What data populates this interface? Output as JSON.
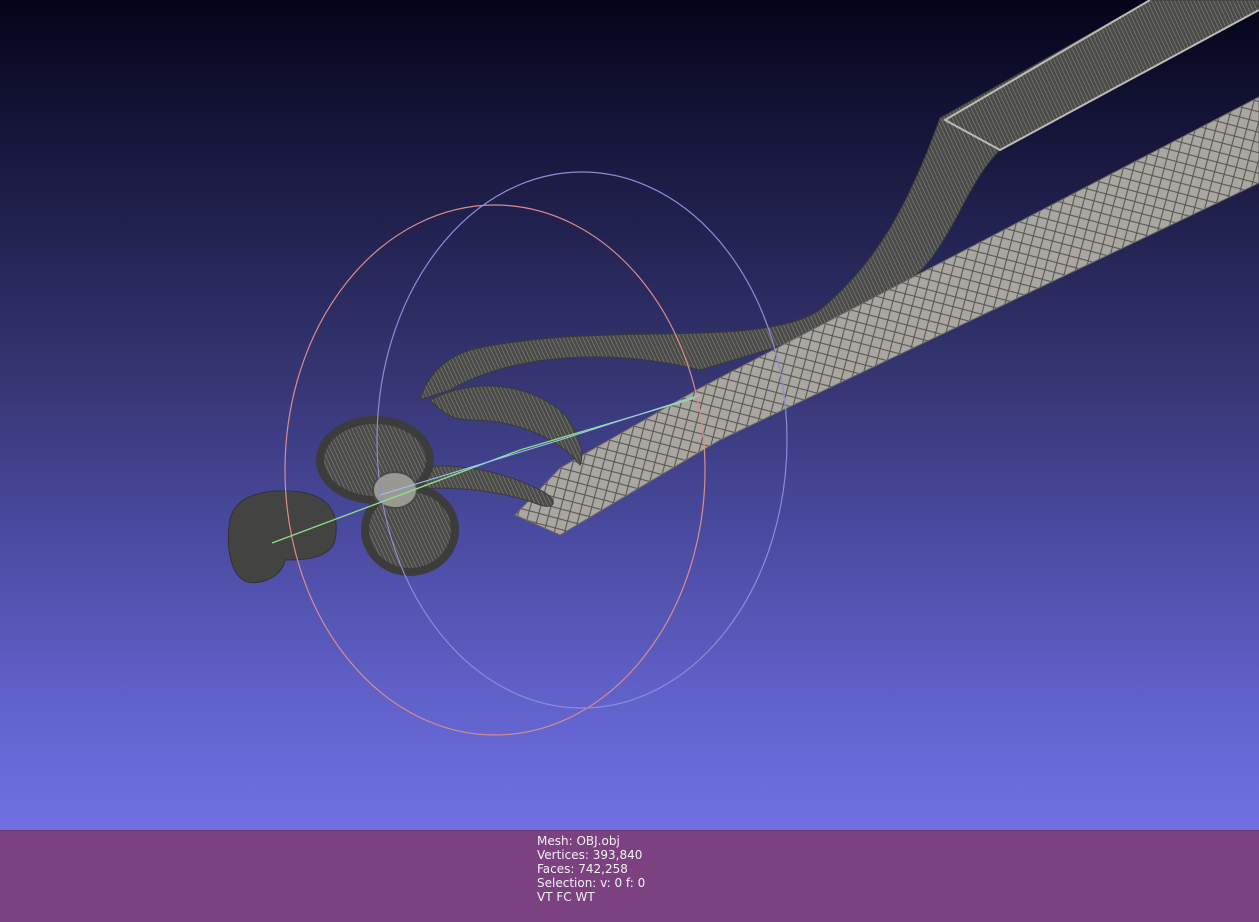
{
  "info": {
    "mesh": "Mesh: OBJ.obj",
    "vertices": "Vertices: 393,840",
    "faces": "Faces: 742,258",
    "selection": "Selection: v: 0 f: 0",
    "render_flags": "VT FC WT"
  },
  "colors": {
    "info_bar": "#7c4180",
    "background_top": "#04041a",
    "background_bottom": "#7070e4",
    "mesh": "#a9a6a2",
    "trackball_x": "#e39090",
    "trackball_y": "#9ce09c",
    "trackball_z": "#9a9aec"
  }
}
